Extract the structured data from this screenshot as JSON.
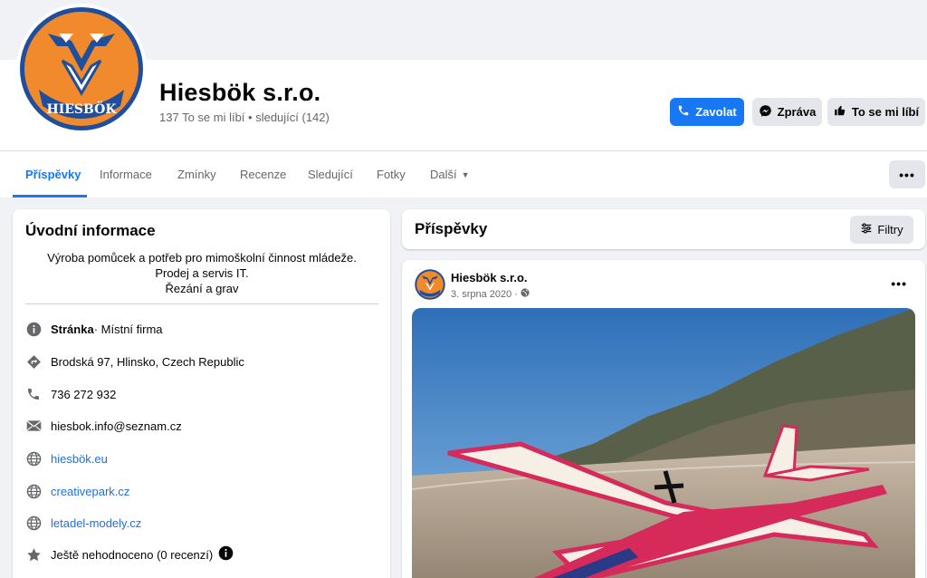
{
  "page": {
    "name": "Hiesbök s.r.o.",
    "stats": "137 To se mi líbí • sledující (142)",
    "logo_text": "HIESBÖK",
    "colors": {
      "accent": "#1877f2",
      "logo_orange": "#f08a2c",
      "logo_blue": "#1f4e9c"
    }
  },
  "actions": {
    "call": "Zavolat",
    "message": "Zpráva",
    "like": "To se mi líbí"
  },
  "tabs": [
    {
      "label": "Příspěvky",
      "active": true
    },
    {
      "label": "Informace"
    },
    {
      "label": "Zmínky"
    },
    {
      "label": "Recenze"
    },
    {
      "label": "Sledující"
    },
    {
      "label": "Fotky"
    },
    {
      "label": "Další"
    }
  ],
  "nav_more": "•••",
  "intro": {
    "title": "Úvodní informace",
    "description": [
      "Výroba pomůcek a potřeb pro mimoškolní činnost mládeže.",
      "Prodej a servis IT.",
      "Řezání a grav"
    ],
    "page_label": "Stránka",
    "page_category": " · Místní firma",
    "address": "Brodská 97, Hlinsko, Czech Republic",
    "phone": "736 272 932",
    "email": "hiesbok.info@seznam.cz",
    "websites": [
      "hiesbök.eu",
      "creativepark.cz",
      "letadel-modely.cz"
    ],
    "rating": "Ještě nehodnoceno (0 recenzí)"
  },
  "posts": {
    "title": "Příspěvky",
    "filter": "Filtry",
    "items": [
      {
        "author": "Hiesbök s.r.o.",
        "date": "3. srpna 2020 ·",
        "menu": "•••"
      }
    ]
  }
}
